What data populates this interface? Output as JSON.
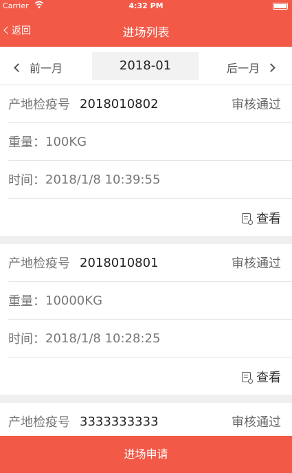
{
  "status_bar": {
    "carrier": "Carrier",
    "time": "4:32 PM"
  },
  "nav": {
    "back_label": "返回",
    "title": "进场列表"
  },
  "month": {
    "prev_label": "前一月",
    "current": "2018-01",
    "next_label": "后一月"
  },
  "records": [
    {
      "quarantine_label": "产地检疫号",
      "quarantine_no": "2018010802",
      "status": "审核通过",
      "weight_label": "重量：",
      "weight": "100KG",
      "time_label": "时间：",
      "time": "2018/1/8 10:39:55",
      "view_label": "查看"
    },
    {
      "quarantine_label": "产地检疫号",
      "quarantine_no": "2018010801",
      "status": "审核通过",
      "weight_label": "重量：",
      "weight": "10000KG",
      "time_label": "时间：",
      "time": "2018/1/8 10:28:25",
      "view_label": "查看"
    },
    {
      "quarantine_label": "产地检疫号",
      "quarantine_no": "3333333333",
      "status": "审核通过"
    }
  ],
  "footer": {
    "apply_label": "进场申请"
  },
  "colors": {
    "accent": "#f25a47",
    "background": "#efefef"
  }
}
